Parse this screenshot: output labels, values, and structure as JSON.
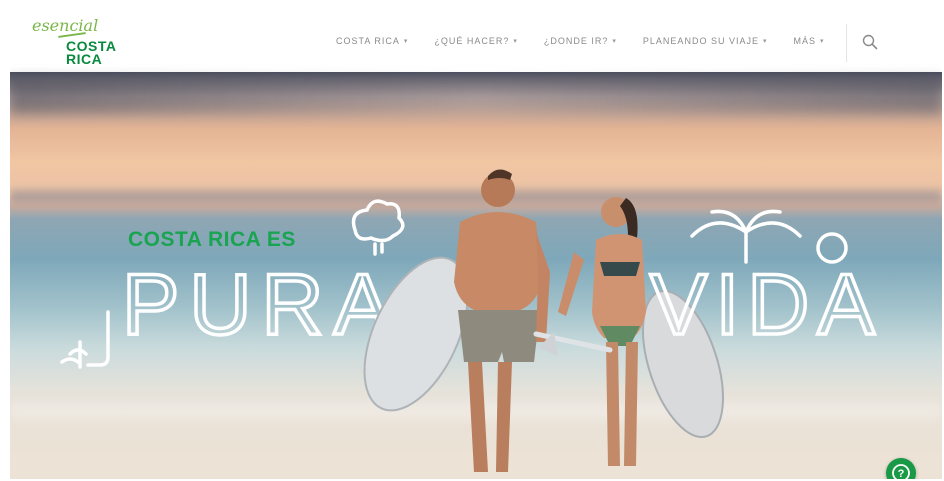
{
  "header": {
    "logo": {
      "script": "esencial",
      "line1": "COSTA",
      "line2": "RICA"
    },
    "nav": [
      {
        "label": "COSTA RICA"
      },
      {
        "label": "¿QUÉ HACER?"
      },
      {
        "label": "¿DONDE IR?"
      },
      {
        "label": "PLANEANDO SU VIAJE"
      },
      {
        "label": "MÁS"
      }
    ],
    "search_icon": "search-icon"
  },
  "hero": {
    "tagline": "COSTA RICA ES",
    "headline_part1": "PURA",
    "headline_part2": "VIDA"
  },
  "help_button": {
    "icon": "chat-help-icon",
    "glyph": "?"
  },
  "colors": {
    "brand_green": "#19a451",
    "logo_green": "#0a8a3f",
    "help_green": "#1a9a46"
  }
}
